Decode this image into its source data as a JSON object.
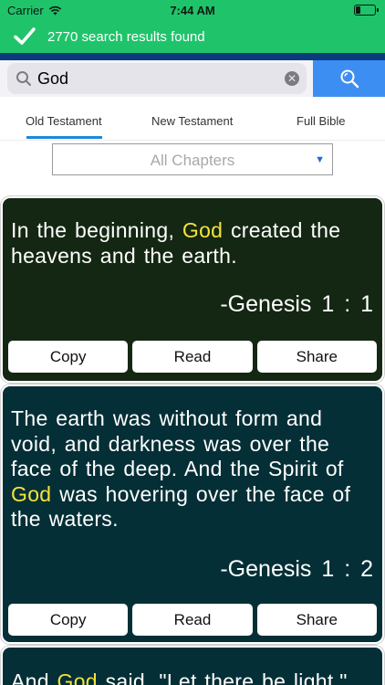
{
  "status_bar": {
    "carrier": "Carrier",
    "time": "7:44 AM",
    "battery_level": 0.25
  },
  "banner": {
    "text": "2770 search results found",
    "icon": "checkmark-icon"
  },
  "search": {
    "value": "God",
    "icons": [
      "search-icon",
      "clear-icon",
      "search-button-icon"
    ]
  },
  "tabs": [
    {
      "label": "Old Testament",
      "active": true
    },
    {
      "label": "New Testament",
      "active": false
    },
    {
      "label": "Full Bible",
      "active": false
    }
  ],
  "chapter_select": {
    "selected": "All Chapters"
  },
  "results": [
    {
      "pre": "In the beginning, ",
      "highlight": "God",
      "post": " created the heavens and the earth.",
      "reference": "-Genesis 1 : 1",
      "background": "#142713"
    },
    {
      "pre": "The earth was without form and void, and darkness was over the face of the deep. And the Spirit of ",
      "highlight": "God",
      "post": " was hovering over the face of the waters.",
      "reference": "-Genesis 1 : 2",
      "background": "#052f36"
    },
    {
      "pre": "And ",
      "highlight": "God",
      "post": " said, \"Let there be light,\"",
      "reference": "",
      "background": "#052f36"
    }
  ],
  "actions": {
    "copy": "Copy",
    "read": "Read",
    "share": "Share"
  },
  "colors": {
    "accent_green": "#1fc46a",
    "search_blue": "#3d8ef2",
    "highlight_yellow": "#f3e33a",
    "tab_underline": "#1a8ad8"
  }
}
